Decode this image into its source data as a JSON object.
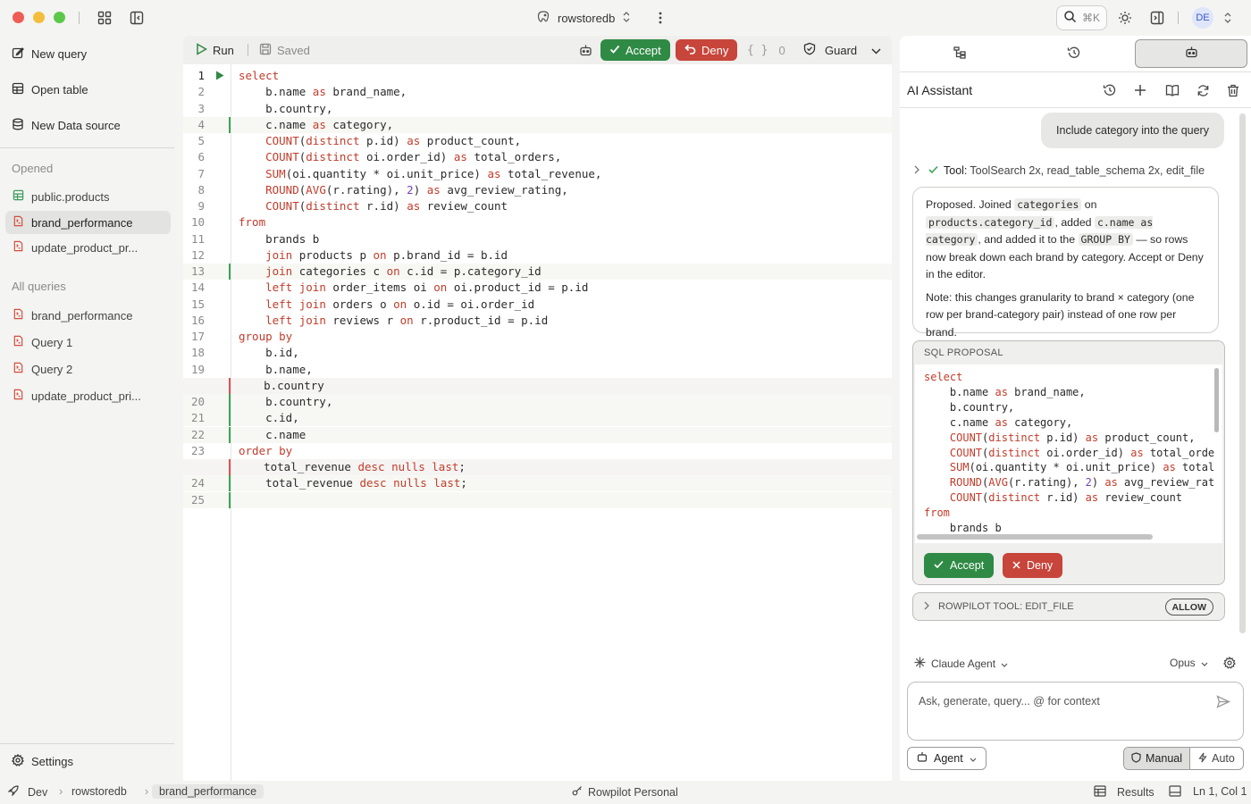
{
  "titlebar": {
    "db_name": "rowstoredb",
    "search_shortcut": "⌘K",
    "avatar_initials": "DE"
  },
  "sidebar": {
    "actions": [
      {
        "label": "New query",
        "icon": "edit-icon"
      },
      {
        "label": "Open table",
        "icon": "table-icon"
      },
      {
        "label": "New Data source",
        "icon": "database-icon"
      }
    ],
    "opened_label": "Opened",
    "opened": [
      {
        "label": "public.products",
        "icon": "table-icon"
      },
      {
        "label": "brand_performance",
        "icon": "sql-file-icon",
        "active": true
      },
      {
        "label": "update_product_pr...",
        "icon": "sql-file-icon"
      }
    ],
    "all_queries_label": "All queries",
    "all_queries": [
      {
        "label": "brand_performance",
        "icon": "sql-file-icon"
      },
      {
        "label": "Query 1",
        "icon": "sql-file-icon"
      },
      {
        "label": "Query 2",
        "icon": "sql-file-icon"
      },
      {
        "label": "update_product_pri...",
        "icon": "sql-file-icon"
      }
    ],
    "settings_label": "Settings"
  },
  "editor_toolbar": {
    "run_label": "Run",
    "saved_label": "Saved",
    "accept_label": "Accept",
    "deny_label": "Deny",
    "params_label": "{ }",
    "params_count": "0",
    "guard_label": "Guard"
  },
  "editor_lines": [
    {
      "n": "1",
      "text": "select",
      "mark": ""
    },
    {
      "n": "2",
      "text": "    b.name as brand_name,",
      "mark": ""
    },
    {
      "n": "3",
      "text": "    b.country,",
      "mark": ""
    },
    {
      "n": "4",
      "text": "    c.name as category,",
      "mark": "added"
    },
    {
      "n": "5",
      "text": "    COUNT(distinct p.id) as product_count,",
      "mark": ""
    },
    {
      "n": "6",
      "text": "    COUNT(distinct oi.order_id) as total_orders,",
      "mark": ""
    },
    {
      "n": "7",
      "text": "    SUM(oi.quantity * oi.unit_price) as total_revenue,",
      "mark": ""
    },
    {
      "n": "8",
      "text": "    ROUND(AVG(r.rating), 2) as avg_review_rating,",
      "mark": ""
    },
    {
      "n": "9",
      "text": "    COUNT(distinct r.id) as review_count",
      "mark": ""
    },
    {
      "n": "10",
      "text": "from",
      "mark": ""
    },
    {
      "n": "11",
      "text": "    brands b",
      "mark": ""
    },
    {
      "n": "12",
      "text": "    join products p on p.brand_id = b.id",
      "mark": ""
    },
    {
      "n": "13",
      "text": "    join categories c on c.id = p.category_id",
      "mark": "added"
    },
    {
      "n": "14",
      "text": "    left join order_items oi on oi.product_id = p.id",
      "mark": ""
    },
    {
      "n": "15",
      "text": "    left join orders o on o.id = oi.order_id",
      "mark": ""
    },
    {
      "n": "16",
      "text": "    left join reviews r on r.product_id = p.id",
      "mark": ""
    },
    {
      "n": "17",
      "text": "group by",
      "mark": ""
    },
    {
      "n": "18",
      "text": "    b.id,",
      "mark": ""
    },
    {
      "n": "19",
      "text": "    b.name,",
      "mark": ""
    },
    {
      "n": "",
      "text": "    b.country",
      "mark": "removed"
    },
    {
      "n": "20",
      "text": "    b.country,",
      "mark": "added"
    },
    {
      "n": "21",
      "text": "    c.id,",
      "mark": "added"
    },
    {
      "n": "22",
      "text": "    c.name",
      "mark": "added"
    },
    {
      "n": "23",
      "text": "order by",
      "mark": ""
    },
    {
      "n": "",
      "text": "    total_revenue desc nulls last;",
      "mark": "removed"
    },
    {
      "n": "24",
      "text": "    total_revenue desc nulls last;",
      "mark": "added"
    },
    {
      "n": "25",
      "text": "",
      "mark": "added"
    }
  ],
  "assistant": {
    "title": "AI Assistant",
    "user_message": "Include category into the query",
    "tool_label": "Tool:",
    "tool_summary": "ToolSearch 2x, read_table_schema 2x, edit_file",
    "response_parts": [
      "Proposed. Joined ",
      "categories",
      " on ",
      "products.category_id",
      ", added ",
      "c.name as category",
      ", and added it to the ",
      "GROUP BY",
      " — so rows now break down each brand by category. Accept or Deny in the editor."
    ],
    "note": "Note: this changes granularity to brand × category (one row per brand-category pair) instead of one row per brand.",
    "sql_proposal_label": "SQL PROPOSAL",
    "sql_lines": [
      "select",
      "    b.name as brand_name,",
      "    b.country,",
      "    c.name as category,",
      "    COUNT(distinct p.id) as product_count,",
      "    COUNT(distinct oi.order_id) as total_orde",
      "    SUM(oi.quantity * oi.unit_price) as total",
      "    ROUND(AVG(r.rating), 2) as avg_review_rat",
      "    COUNT(distinct r.id) as review_count",
      "from",
      "    brands b"
    ],
    "accept_label": "Accept",
    "deny_label": "Deny",
    "tool_row_label": "ROWPILOT TOOL: EDIT_FILE",
    "allow_label": "ALLOW",
    "agent_name": "Claude Agent",
    "model_name": "Opus",
    "composer_placeholder": "Ask, generate, query... @ for context",
    "mode_label": "Agent",
    "manual_label": "Manual",
    "auto_label": "Auto"
  },
  "statusbar": {
    "env": "Dev",
    "crumb_db": "rowstoredb",
    "crumb_file": "brand_performance",
    "workspace": "Rowpilot Personal",
    "results_label": "Results",
    "cursor": "Ln 1, Col 1"
  },
  "colors": {
    "accept": "#2f8a45",
    "deny": "#c7453b",
    "keyword": "#c23c2b",
    "added_bar": "#3aa457",
    "removed_bar": "#d9534f"
  }
}
